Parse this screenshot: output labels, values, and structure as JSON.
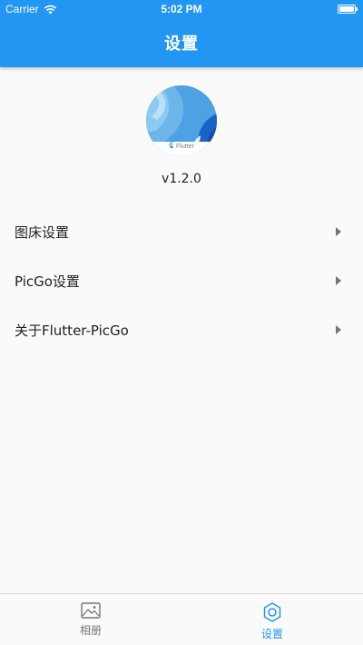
{
  "status_bar": {
    "carrier": "Carrier",
    "time": "5:02 PM",
    "wifi_icon": "wifi-icon",
    "battery_icon": "battery-icon"
  },
  "app_bar": {
    "title": "设置"
  },
  "about": {
    "logo_icon": "flutter-app-logo",
    "logo_text": "Flutter",
    "version": "v1.2.0"
  },
  "menu": {
    "items": [
      {
        "label": "图床设置",
        "icon": "chevron-right-icon"
      },
      {
        "label": "PicGo设置",
        "icon": "chevron-right-icon"
      },
      {
        "label": "关于Flutter-PicGo",
        "icon": "chevron-right-icon"
      }
    ]
  },
  "bottom_nav": {
    "items": [
      {
        "label": "相册",
        "icon": "image-icon",
        "active": false
      },
      {
        "label": "设置",
        "icon": "gear-icon",
        "active": true
      }
    ]
  },
  "colors": {
    "primary": "#2196f3",
    "background": "#fafafa",
    "inactive": "#757575",
    "text": "#222222"
  }
}
